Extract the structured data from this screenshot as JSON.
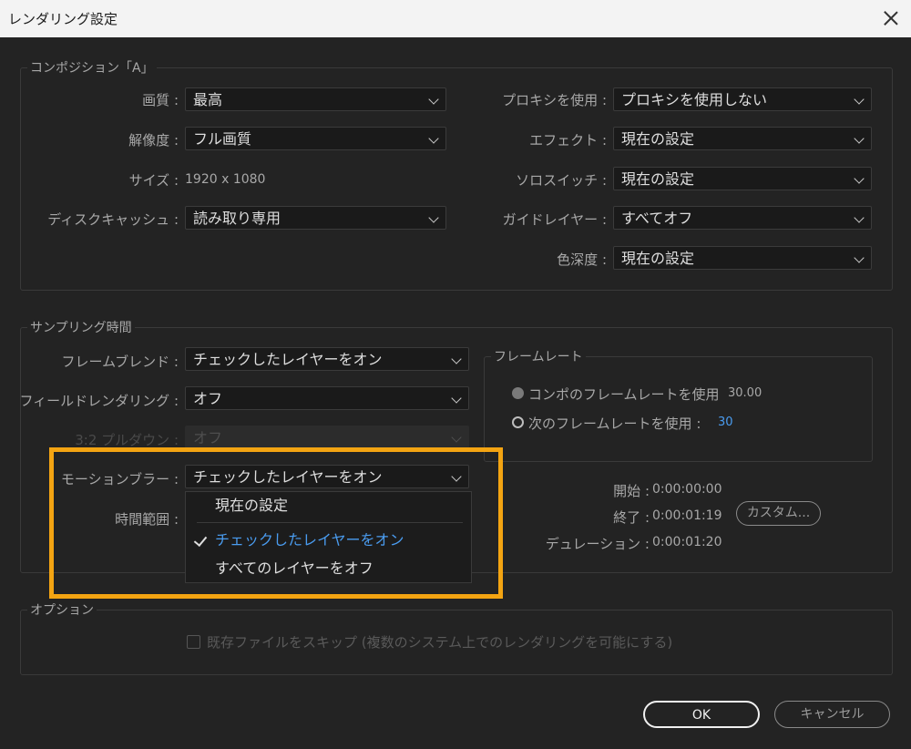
{
  "window": {
    "title": "レンダリング設定"
  },
  "composition": {
    "legend": "コンポジション「A」",
    "quality": {
      "label": "画質 :",
      "value": "最高"
    },
    "resolution": {
      "label": "解像度 :",
      "value": "フル画質"
    },
    "size": {
      "label": "サイズ :",
      "value": "1920 x 1080"
    },
    "disk_cache": {
      "label": "ディスクキャッシュ :",
      "value": "読み取り専用"
    },
    "proxy": {
      "label": "プロキシを使用 :",
      "value": "プロキシを使用しない"
    },
    "effects": {
      "label": "エフェクト :",
      "value": "現在の設定"
    },
    "solo": {
      "label": "ソロスイッチ :",
      "value": "現在の設定"
    },
    "guide": {
      "label": "ガイドレイヤー :",
      "value": "すべてオフ"
    },
    "color_depth": {
      "label": "色深度 :",
      "value": "現在の設定"
    }
  },
  "sampling": {
    "legend": "サンプリング時間",
    "frame_blend": {
      "label": "フレームブレンド :",
      "value": "チェックしたレイヤーをオン"
    },
    "field_render": {
      "label": "フィールドレンダリング :",
      "value": "オフ"
    },
    "pulldown": {
      "label": "3:2 プルダウン :",
      "value": "オフ"
    },
    "motion_blur": {
      "label": "モーションブラー :",
      "value": "チェックしたレイヤーをオン"
    },
    "time_span": {
      "label": "時間範囲 :"
    },
    "framerate": {
      "legend": "フレームレート",
      "use_comp": {
        "label": "コンポのフレームレートを使用",
        "value": "30.00"
      },
      "use_this": {
        "label": "次のフレームレートを使用 :",
        "value": "30"
      }
    },
    "start": {
      "label": "開始 :",
      "value": "0:00:00:00"
    },
    "end": {
      "label": "終了 :",
      "value": "0:00:01:19"
    },
    "duration": {
      "label": "デュレーション :",
      "value": "0:00:01:20"
    },
    "custom_label": "カスタム..."
  },
  "dropdown_menu": {
    "items": [
      "現在の設定",
      "チェックしたレイヤーをオン",
      "すべてのレイヤーをオフ"
    ],
    "selected_index": 1
  },
  "options": {
    "legend": "オプション",
    "skip_existing": {
      "label": "既存ファイルをスキップ (複数のシステム上でのレンダリングを可能にする)",
      "checked": false
    }
  },
  "buttons": {
    "ok": "OK",
    "cancel": "キャンセル"
  },
  "colors": {
    "highlight": "#f3a412",
    "accent": "#4a9cf0"
  }
}
